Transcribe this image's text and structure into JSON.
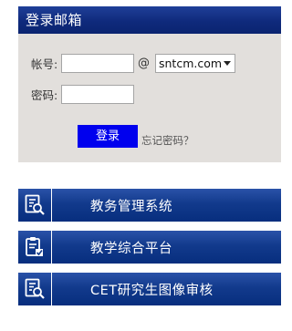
{
  "login": {
    "title": "登录邮箱",
    "account_label": "帐号:",
    "account_value": "",
    "at_sign": "@",
    "domain_selected": "sntcm.com",
    "password_label": "密码:",
    "password_value": "",
    "submit_label": "登录",
    "forgot_label": "忘记密码？"
  },
  "links": [
    {
      "label": "教务管理系统",
      "icon": "document-search-icon"
    },
    {
      "label": "教学综合平台",
      "icon": "clipboard-check-icon"
    },
    {
      "label": "CET研究生图像审核",
      "icon": "document-search-icon"
    }
  ],
  "colors": {
    "header_blue": "#0f2a7c",
    "panel_bg": "#e2dfdc",
    "button_blue": "#0000ee",
    "tile_blue": "#123a8c"
  }
}
